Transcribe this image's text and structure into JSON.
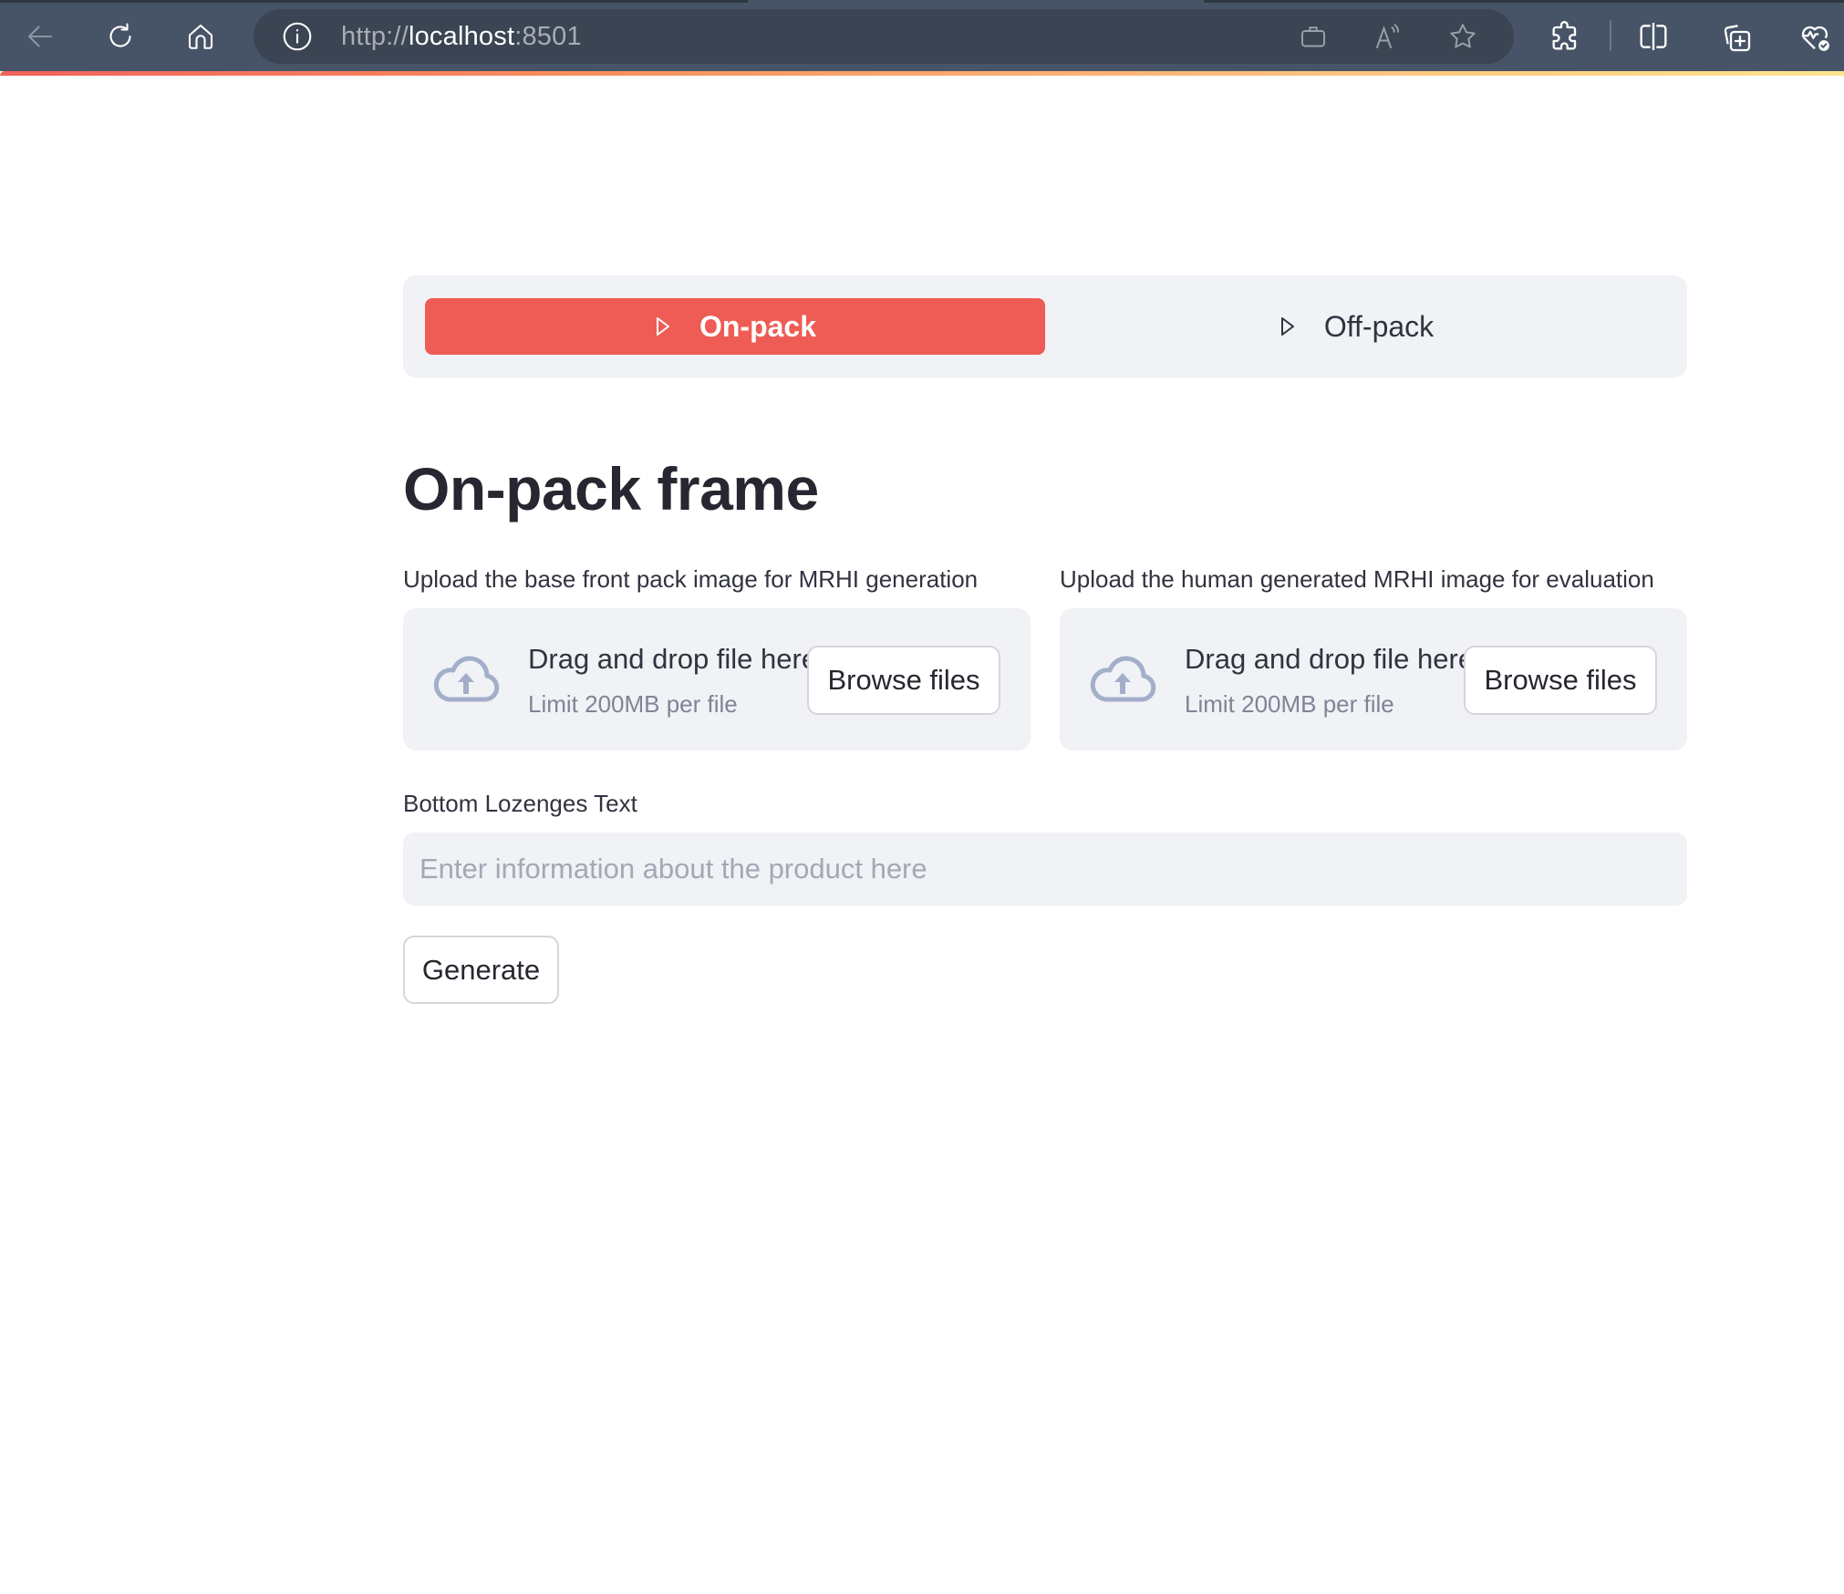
{
  "browser": {
    "url_scheme": "http://",
    "url_host": "localhost",
    "url_port": ":8501",
    "icons": {
      "back": "arrow-left-icon",
      "reload": "reload-icon",
      "home": "home-icon",
      "site_info": "info-circle-icon",
      "briefcase": "briefcase-icon",
      "read_aloud": "read-aloud-icon",
      "favorite": "star-icon",
      "extensions": "puzzle-icon",
      "split_screen": "split-screen-icon",
      "collections": "collections-add-icon",
      "browser_essentials": "heart-pulse-check-icon"
    }
  },
  "colors": {
    "accent": "#ee5c55",
    "panel_bg": "#f0f2f6",
    "text": "#31333f",
    "muted": "#808495",
    "chrome_bg": "#475467"
  },
  "nav": {
    "tabs": [
      {
        "label": "On-pack",
        "active": true,
        "icon": "play-outline-icon"
      },
      {
        "label": "Off-pack",
        "active": false,
        "icon": "play-outline-icon"
      }
    ]
  },
  "main": {
    "title": "On-pack frame",
    "uploaders": [
      {
        "label": "Upload the base front pack image for MRHI generation",
        "drag_text": "Drag and drop file here",
        "limit_text": "Limit 200MB per file",
        "button_label": "Browse files",
        "icon": "cloud-upload-icon"
      },
      {
        "label": "Upload the human generated MRHI image for evaluation",
        "drag_text": "Drag and drop file here",
        "limit_text": "Limit 200MB per file",
        "button_label": "Browse files",
        "icon": "cloud-upload-icon"
      }
    ],
    "lozenges": {
      "label": "Bottom Lozenges Text",
      "value": "",
      "placeholder": "Enter information about the product here"
    },
    "generate_label": "Generate"
  }
}
